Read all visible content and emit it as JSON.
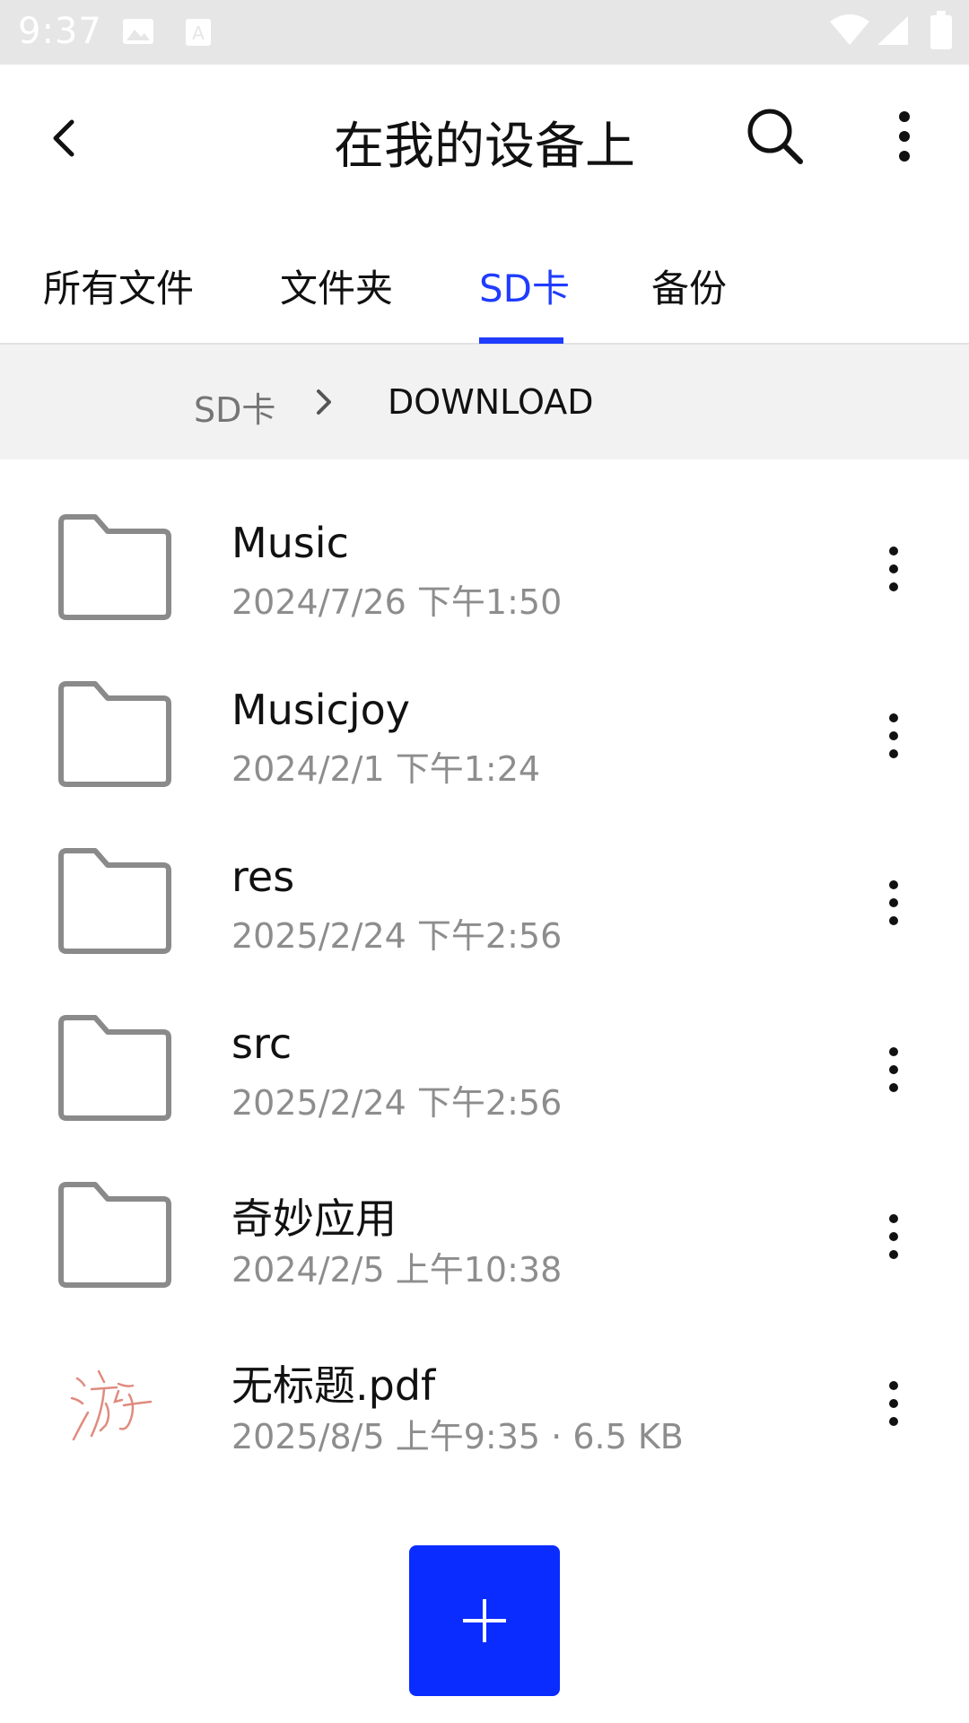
{
  "status_bar": {
    "time": "9:37"
  },
  "app_bar": {
    "title": "在我的设备上"
  },
  "tabs": [
    {
      "label": "所有文件",
      "active": false
    },
    {
      "label": "文件夹",
      "active": false
    },
    {
      "label": "SD卡",
      "active": true
    },
    {
      "label": "备份",
      "active": false
    }
  ],
  "breadcrumb": {
    "root": "SD卡",
    "current": "DOWNLOAD"
  },
  "files": [
    {
      "name": "Music",
      "meta": "2024/7/26 下午1:50",
      "icon": "folder-icon"
    },
    {
      "name": "Musicjoy",
      "meta": "2024/2/1 下午1:24",
      "icon": "folder-icon"
    },
    {
      "name": "res",
      "meta": "2025/2/24 下午2:56",
      "icon": "folder-icon"
    },
    {
      "name": "src",
      "meta": "2025/2/24 下午2:56",
      "icon": "folder-icon"
    },
    {
      "name": "奇妙应用",
      "meta": "2024/2/5 上午10:38",
      "icon": "folder-icon"
    },
    {
      "name": "无标题.pdf",
      "meta": "2025/8/5 上午9:35 · 6.5 KB",
      "icon": "pdf-thumbnail"
    }
  ],
  "fab": {
    "icon": "plus-icon"
  },
  "colors": {
    "accent": "#1f3cff",
    "fab": "#0a2cff",
    "secondary_text": "#8d8d8d",
    "breadcrumb_bg": "#f2f2f2",
    "status_bar_bg": "#e6e6e6"
  }
}
